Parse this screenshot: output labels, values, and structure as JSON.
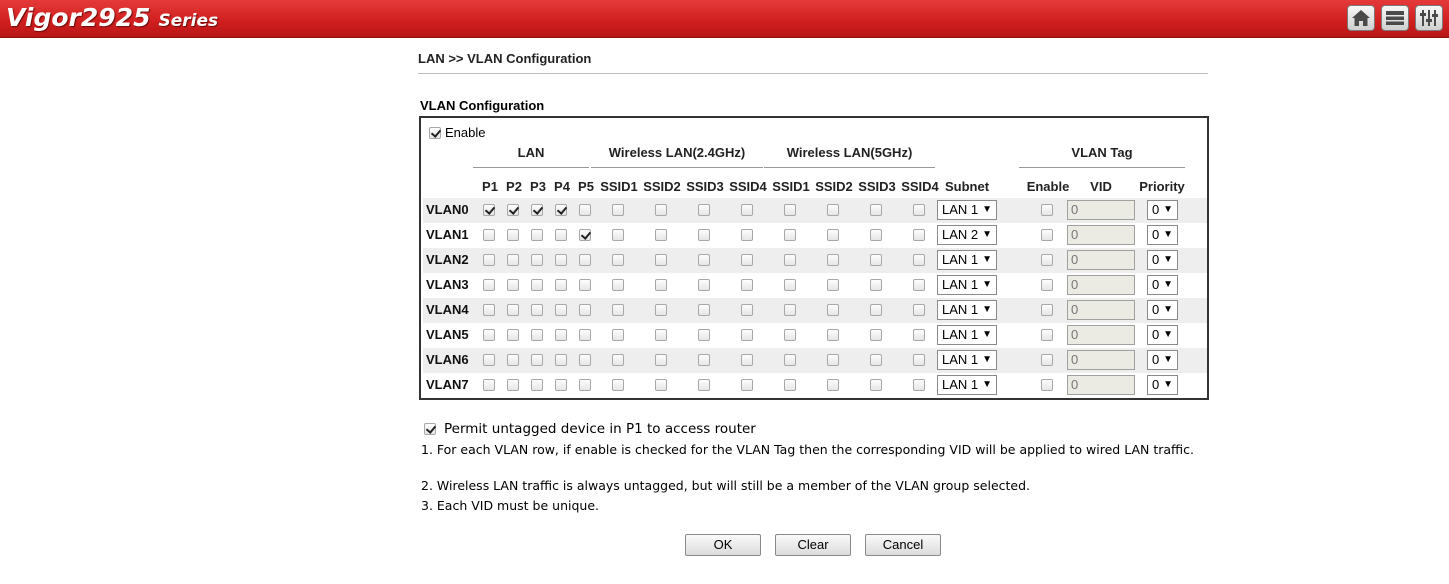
{
  "header": {
    "brand_model": "Vigor2925",
    "brand_series": "Series",
    "icons": [
      "home-icon",
      "menu-icon",
      "settings-sliders-icon"
    ]
  },
  "breadcrumb": "LAN >> VLAN Configuration",
  "section_title": "VLAN Configuration",
  "enable": {
    "label": "Enable",
    "checked": true
  },
  "groups": {
    "lan": "LAN",
    "wlan24": "Wireless LAN(2.4GHz)",
    "wlan5": "Wireless LAN(5GHz)",
    "vlan_tag": "VLAN Tag"
  },
  "columns": {
    "ports": [
      "P1",
      "P2",
      "P3",
      "P4",
      "P5"
    ],
    "ssid24": [
      "SSID1",
      "SSID2",
      "SSID3",
      "SSID4"
    ],
    "ssid5": [
      "SSID1",
      "SSID2",
      "SSID3",
      "SSID4"
    ],
    "subnet": "Subnet",
    "tag_enable": "Enable",
    "vid": "VID",
    "priority": "Priority"
  },
  "rows": [
    {
      "name": "VLAN0",
      "ports": [
        true,
        true,
        true,
        true,
        false
      ],
      "subnet": "LAN 1",
      "vid": "0",
      "priority": "0"
    },
    {
      "name": "VLAN1",
      "ports": [
        false,
        false,
        false,
        false,
        true
      ],
      "subnet": "LAN 2",
      "vid": "0",
      "priority": "0"
    },
    {
      "name": "VLAN2",
      "ports": [
        false,
        false,
        false,
        false,
        false
      ],
      "subnet": "LAN 1",
      "vid": "0",
      "priority": "0"
    },
    {
      "name": "VLAN3",
      "ports": [
        false,
        false,
        false,
        false,
        false
      ],
      "subnet": "LAN 1",
      "vid": "0",
      "priority": "0"
    },
    {
      "name": "VLAN4",
      "ports": [
        false,
        false,
        false,
        false,
        false
      ],
      "subnet": "LAN 1",
      "vid": "0",
      "priority": "0"
    },
    {
      "name": "VLAN5",
      "ports": [
        false,
        false,
        false,
        false,
        false
      ],
      "subnet": "LAN 1",
      "vid": "0",
      "priority": "0"
    },
    {
      "name": "VLAN6",
      "ports": [
        false,
        false,
        false,
        false,
        false
      ],
      "subnet": "LAN 1",
      "vid": "0",
      "priority": "0"
    },
    {
      "name": "VLAN7",
      "ports": [
        false,
        false,
        false,
        false,
        false
      ],
      "subnet": "LAN 1",
      "vid": "0",
      "priority": "0"
    }
  ],
  "permit": {
    "label": "Permit untagged device in P1 to access router",
    "checked": true
  },
  "notes": [
    "1. For each VLAN row, if enable is checked for the VLAN Tag then the corresponding VID will be applied to wired LAN traffic.",
    "2. Wireless LAN traffic is always untagged, but will still be a member of the VLAN group selected.",
    "3. Each VID must be unique."
  ],
  "buttons": {
    "ok": "OK",
    "clear": "Clear",
    "cancel": "Cancel"
  }
}
